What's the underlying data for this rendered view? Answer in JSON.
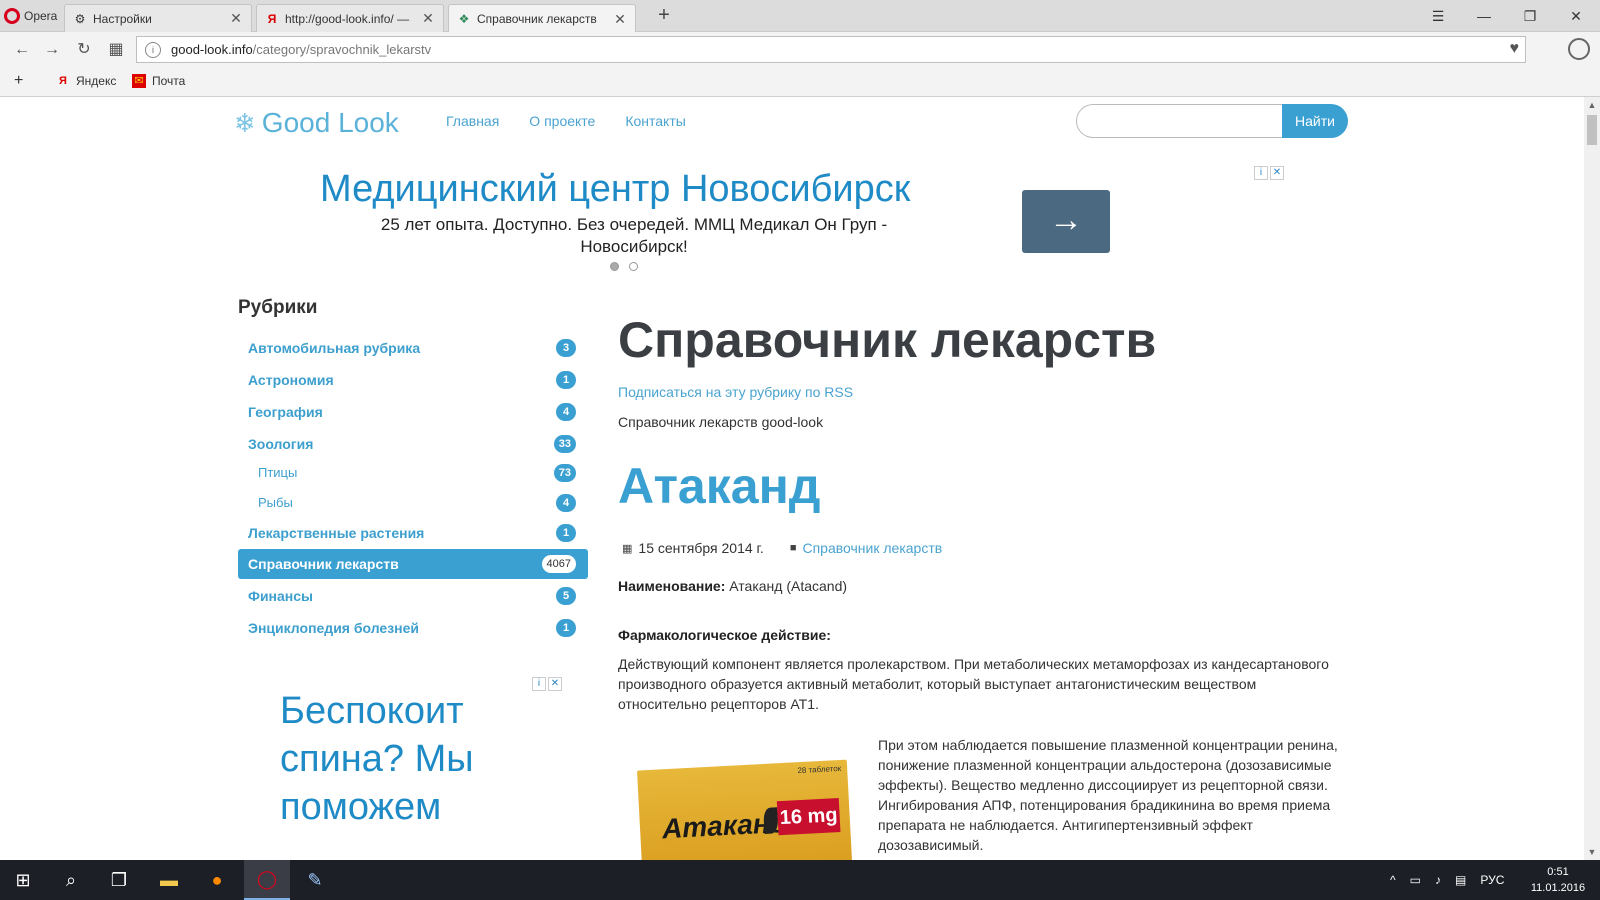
{
  "browser": {
    "opera_label": "Opera",
    "tabs": [
      {
        "title": "Настройки",
        "icon": "gear-icon",
        "active": false
      },
      {
        "title": "http://good-look.info/ —",
        "icon": "yandex-icon",
        "active": false
      },
      {
        "title": "Справочник лекарств",
        "icon": "site-favicon",
        "active": true
      }
    ],
    "new_tab": "+",
    "url_domain": "good-look.info",
    "url_path": "/category/spravochnik_lekarstv",
    "bookmarks": [
      {
        "label": "Яндекс",
        "icon": "yandex-icon"
      },
      {
        "label": "Почта",
        "icon": "mail-icon"
      }
    ],
    "bookmark_add": "+"
  },
  "site": {
    "logo": "Good Look",
    "nav": [
      "Главная",
      "О проекте",
      "Контакты"
    ],
    "search": {
      "placeholder": "",
      "button": "Найти"
    }
  },
  "ad_top": {
    "headline": "Медицинский центр Новосибирск",
    "description": "25 лет опыта. Доступно. Без очередей. ММЦ Медикал Он Груп - Новосибирск!",
    "arrow": "→"
  },
  "sidebar": {
    "heading": "Рубрики",
    "categories": [
      {
        "label": "Автомобильная рубрика",
        "count": "3",
        "sub": false,
        "active": false
      },
      {
        "label": "Астрономия",
        "count": "1",
        "sub": false,
        "active": false
      },
      {
        "label": "География",
        "count": "4",
        "sub": false,
        "active": false
      },
      {
        "label": "Зоология",
        "count": "33",
        "sub": false,
        "active": false
      },
      {
        "label": "Птицы",
        "count": "73",
        "sub": true,
        "active": false
      },
      {
        "label": "Рыбы",
        "count": "4",
        "sub": true,
        "active": false
      },
      {
        "label": "Лекарственные растения",
        "count": "1",
        "sub": false,
        "active": false
      },
      {
        "label": "Справочник лекарств",
        "count": "4067",
        "sub": false,
        "active": true
      },
      {
        "label": "Финансы",
        "count": "5",
        "sub": false,
        "active": false
      },
      {
        "label": "Энциклопедия болезней",
        "count": "1",
        "sub": false,
        "active": false
      }
    ]
  },
  "ad_side": {
    "headline": "Беспокоит спина? Мы поможем"
  },
  "main": {
    "title": "Справочник лекарств",
    "rss": "Подписаться на эту рубрику по RSS",
    "description": "Справочник лекарств good-look",
    "post": {
      "title": "Атаканд",
      "date": "15 сентября 2014 г.",
      "category": "Справочник лекарств",
      "name_label": "Наименование:",
      "name_value": " Атаканд (Atacand)",
      "pharm_heading": "Фармакологическое действие:",
      "para1_line1": "Действующий компонент является пролекарством. При метаболических метаморфозах из кандесартанового",
      "para1_line2": "производного образуется активный метаболит, который выступает антагонистическим веществом",
      "para1_line3": "относительно рецепторов АТ1.",
      "para2": "При этом наблюдается повышение плазменной концентрации ренина, понижение плазменной концентрации альдостерона (дозозависимые эффекты). Вещество медленно диссоциирует из рецепторной связи. Ингибирования АПФ, потенцирования брадикинина во время приема препарата не наблюдается. Антигипертензивный эффект дозозависимый.",
      "pack_title": "Атаканд",
      "pack_dose": "16 mg",
      "pack_small": "28 таблеток"
    }
  },
  "taskbar": {
    "language": "РУС",
    "time": "0:51",
    "date": "11.01.2016"
  }
}
